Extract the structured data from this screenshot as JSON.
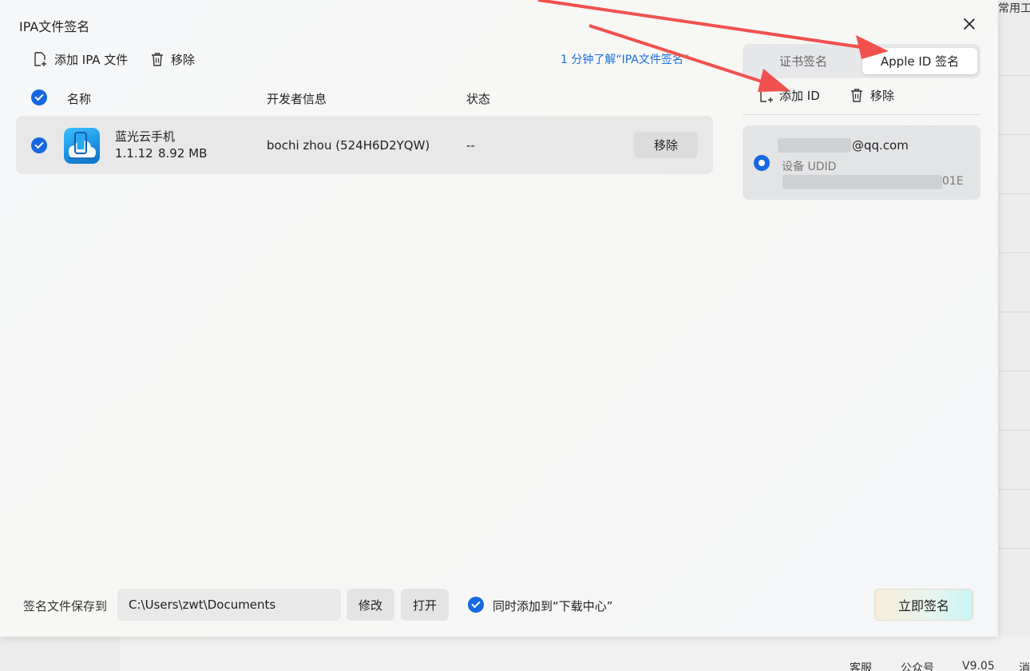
{
  "background": {
    "corner_text": "常用工",
    "status_bar": [
      "客服",
      "公众号",
      "V9.05",
      "消"
    ]
  },
  "dialog": {
    "title": "IPA文件签名",
    "close_icon": "close-icon"
  },
  "toolbar": {
    "add_ipa_label": "添加 IPA 文件",
    "remove_label": "移除",
    "help_link": "1 分钟了解“IPA文件签名”"
  },
  "table": {
    "headers": [
      "名称",
      "开发者信息",
      "状态"
    ],
    "rows": [
      {
        "name": "蓝光云手机",
        "version": "1.1.12",
        "size": "8.92 MB",
        "developer": "bochi zhou (524H6D2YQW)",
        "status": "--",
        "remove_label": "移除",
        "checked": true
      }
    ]
  },
  "right_panel": {
    "tabs": [
      {
        "label": "证书签名",
        "active": false
      },
      {
        "label": "Apple ID 签名",
        "active": true
      }
    ],
    "add_id_label": "添加 ID",
    "remove_label": "移除",
    "accounts": [
      {
        "email_suffix": "@qq.com",
        "udid_label": "设备 UDID",
        "udid_suffix": "01E",
        "selected": true
      }
    ]
  },
  "footer": {
    "save_label": "签名文件保存到",
    "path_value": "C:\\Users\\zwt\\Documents",
    "modify_label": "修改",
    "open_label": "打开",
    "add_to_download_label": "同时添加到“下载中心”",
    "add_to_download_checked": true,
    "sign_now_label": "立即签名"
  },
  "colors": {
    "accent": "#1568e0",
    "link": "#1a6fe0",
    "arrow": "#f0514e"
  }
}
